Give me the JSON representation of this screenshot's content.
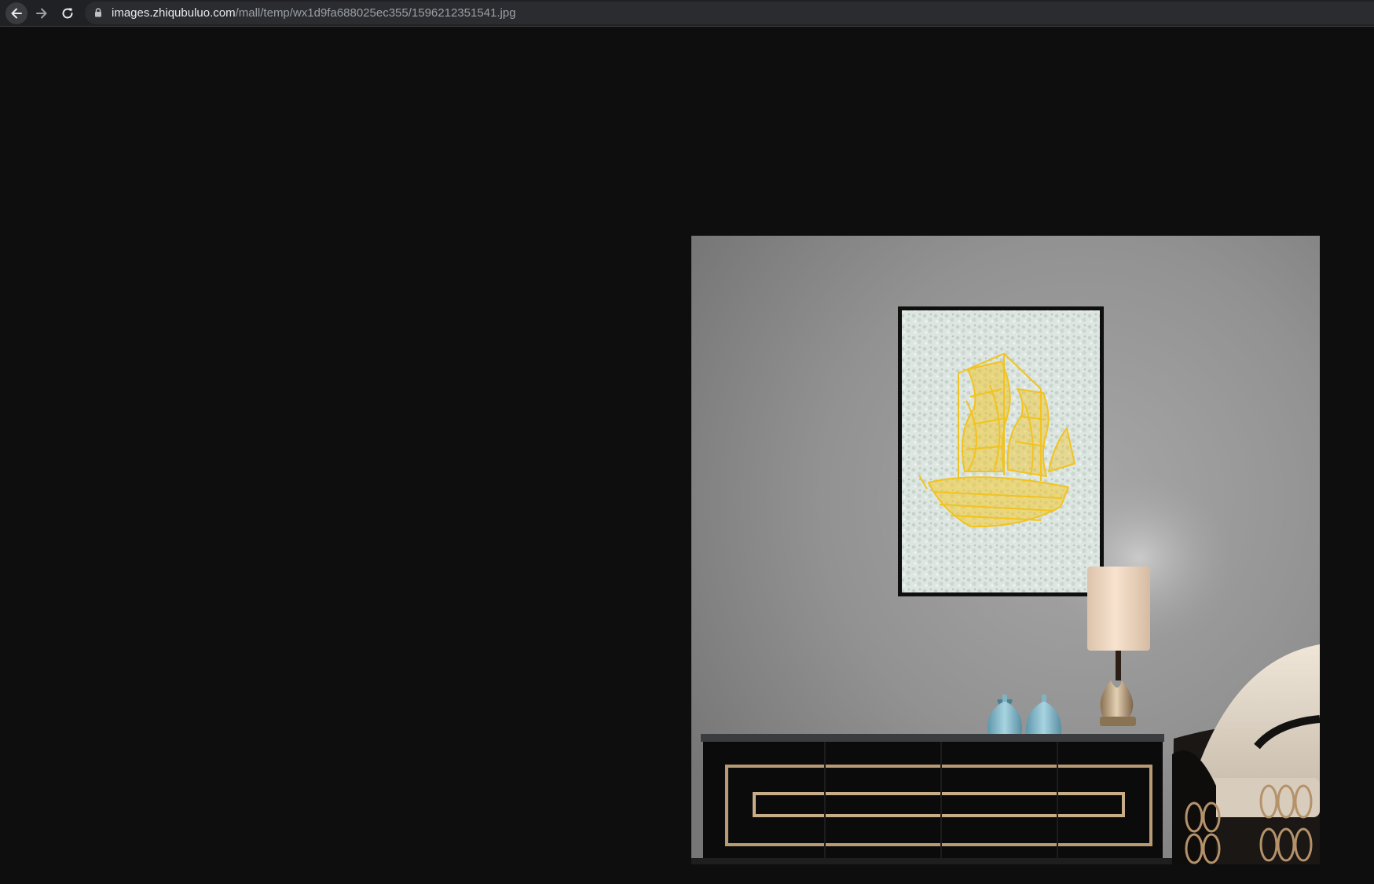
{
  "browser": {
    "url_host": "images.zhiqubuluo.com",
    "url_path": "/mall/temp/wx1d9fa688025ec355/1596212351541.jpg",
    "icons": {
      "back": "arrow-left-icon",
      "forward": "arrow-right-icon",
      "reload": "reload-icon",
      "secure": "lock-icon"
    }
  },
  "colors": {
    "viewer_background": "#0e0e0e",
    "toolbar_background": "#202124",
    "wall": "#8f8f8f",
    "ship": "#f2c31f",
    "canvas": "#d9e3de",
    "cabinet": "#0b0b0c",
    "brass_trim": "#b89a74",
    "vase": "#7fb4c6",
    "lamp_shade": "#f1d9c2"
  }
}
